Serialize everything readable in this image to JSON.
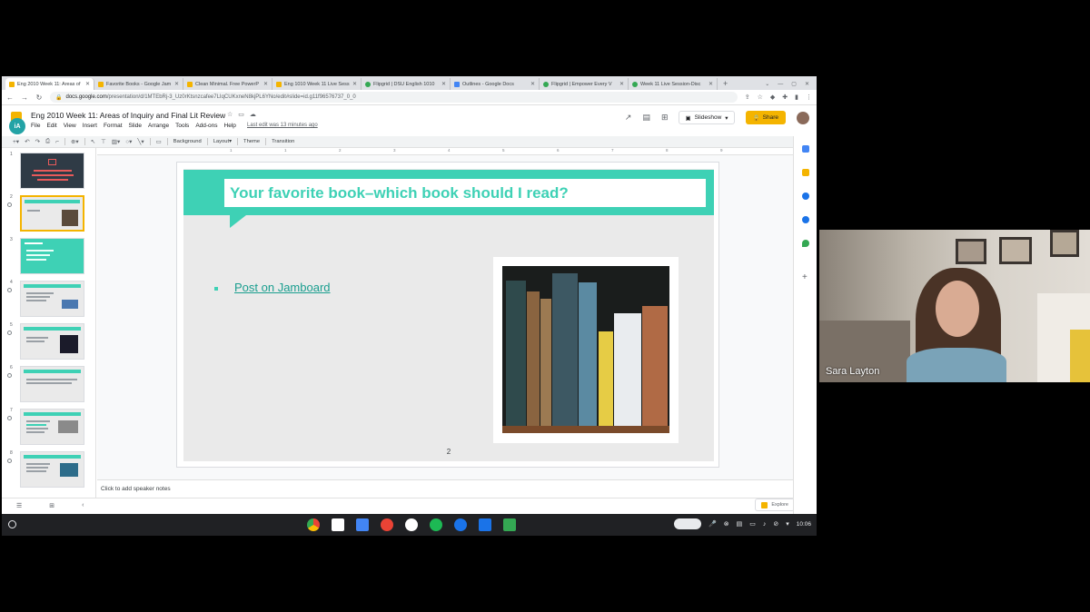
{
  "tabs": [
    {
      "title": "Eng 2010 Week 11: Areas of",
      "active": true,
      "color": "#f4b400"
    },
    {
      "title": "Favorite Books - Google Jam",
      "active": false,
      "color": "#f4b400"
    },
    {
      "title": "Clean Minimal. Free PowerP",
      "active": false,
      "color": "#f4b400"
    },
    {
      "title": "Eng 1010 Week 11 Live Sess",
      "active": false,
      "color": "#f4b400"
    },
    {
      "title": "Flipgrid | DSU English 1010",
      "active": false,
      "color": "#34a853"
    },
    {
      "title": "Outlines - Google Docs",
      "active": false,
      "color": "#4285f4"
    },
    {
      "title": "Flipgrid | Empower Every V",
      "active": false,
      "color": "#34a853"
    },
    {
      "title": "Week 11 Live Session-Disc",
      "active": false,
      "color": "#34a853"
    }
  ],
  "omnibox": {
    "domain": "docs.google.com",
    "path": "/presentation/d/1MTEbRj-3_Uz0rKtsnzcafee7LIqCUKxneN8kjPL6YNo/edit#slide=id.g11f96576737_0_0"
  },
  "doc": {
    "title": "Eng 2010 Week 11: Areas of Inquiry and Final Lit Review",
    "last_edit": "Last edit was 13 minutes ago",
    "menu": [
      "File",
      "Edit",
      "View",
      "Insert",
      "Format",
      "Slide",
      "Arrange",
      "Tools",
      "Add-ons",
      "Help"
    ],
    "slideshow_label": "Slideshow",
    "share_label": "Share",
    "badge": "iA"
  },
  "toolbar": {
    "background": "Background",
    "layout": "Layout",
    "theme": "Theme",
    "transition": "Transition"
  },
  "ruler_ticks": [
    "1",
    "1",
    "2",
    "3",
    "4",
    "5",
    "6",
    "7",
    "8",
    "9"
  ],
  "filmstrip": {
    "slides": [
      {
        "num": "1"
      },
      {
        "num": "2"
      },
      {
        "num": "3"
      },
      {
        "num": "4"
      },
      {
        "num": "5"
      },
      {
        "num": "6"
      },
      {
        "num": "7"
      },
      {
        "num": "8"
      }
    ]
  },
  "slide": {
    "title": "Your favorite book–which book should I read?",
    "bullet": "Post on Jamboard",
    "number": "2",
    "accent": "#3ed1b5"
  },
  "notes": {
    "placeholder": "Click to add speaker notes"
  },
  "explore_label": "Explore",
  "shelf": {
    "time": "10:06"
  },
  "video": {
    "speaker": "Sara Layton"
  }
}
